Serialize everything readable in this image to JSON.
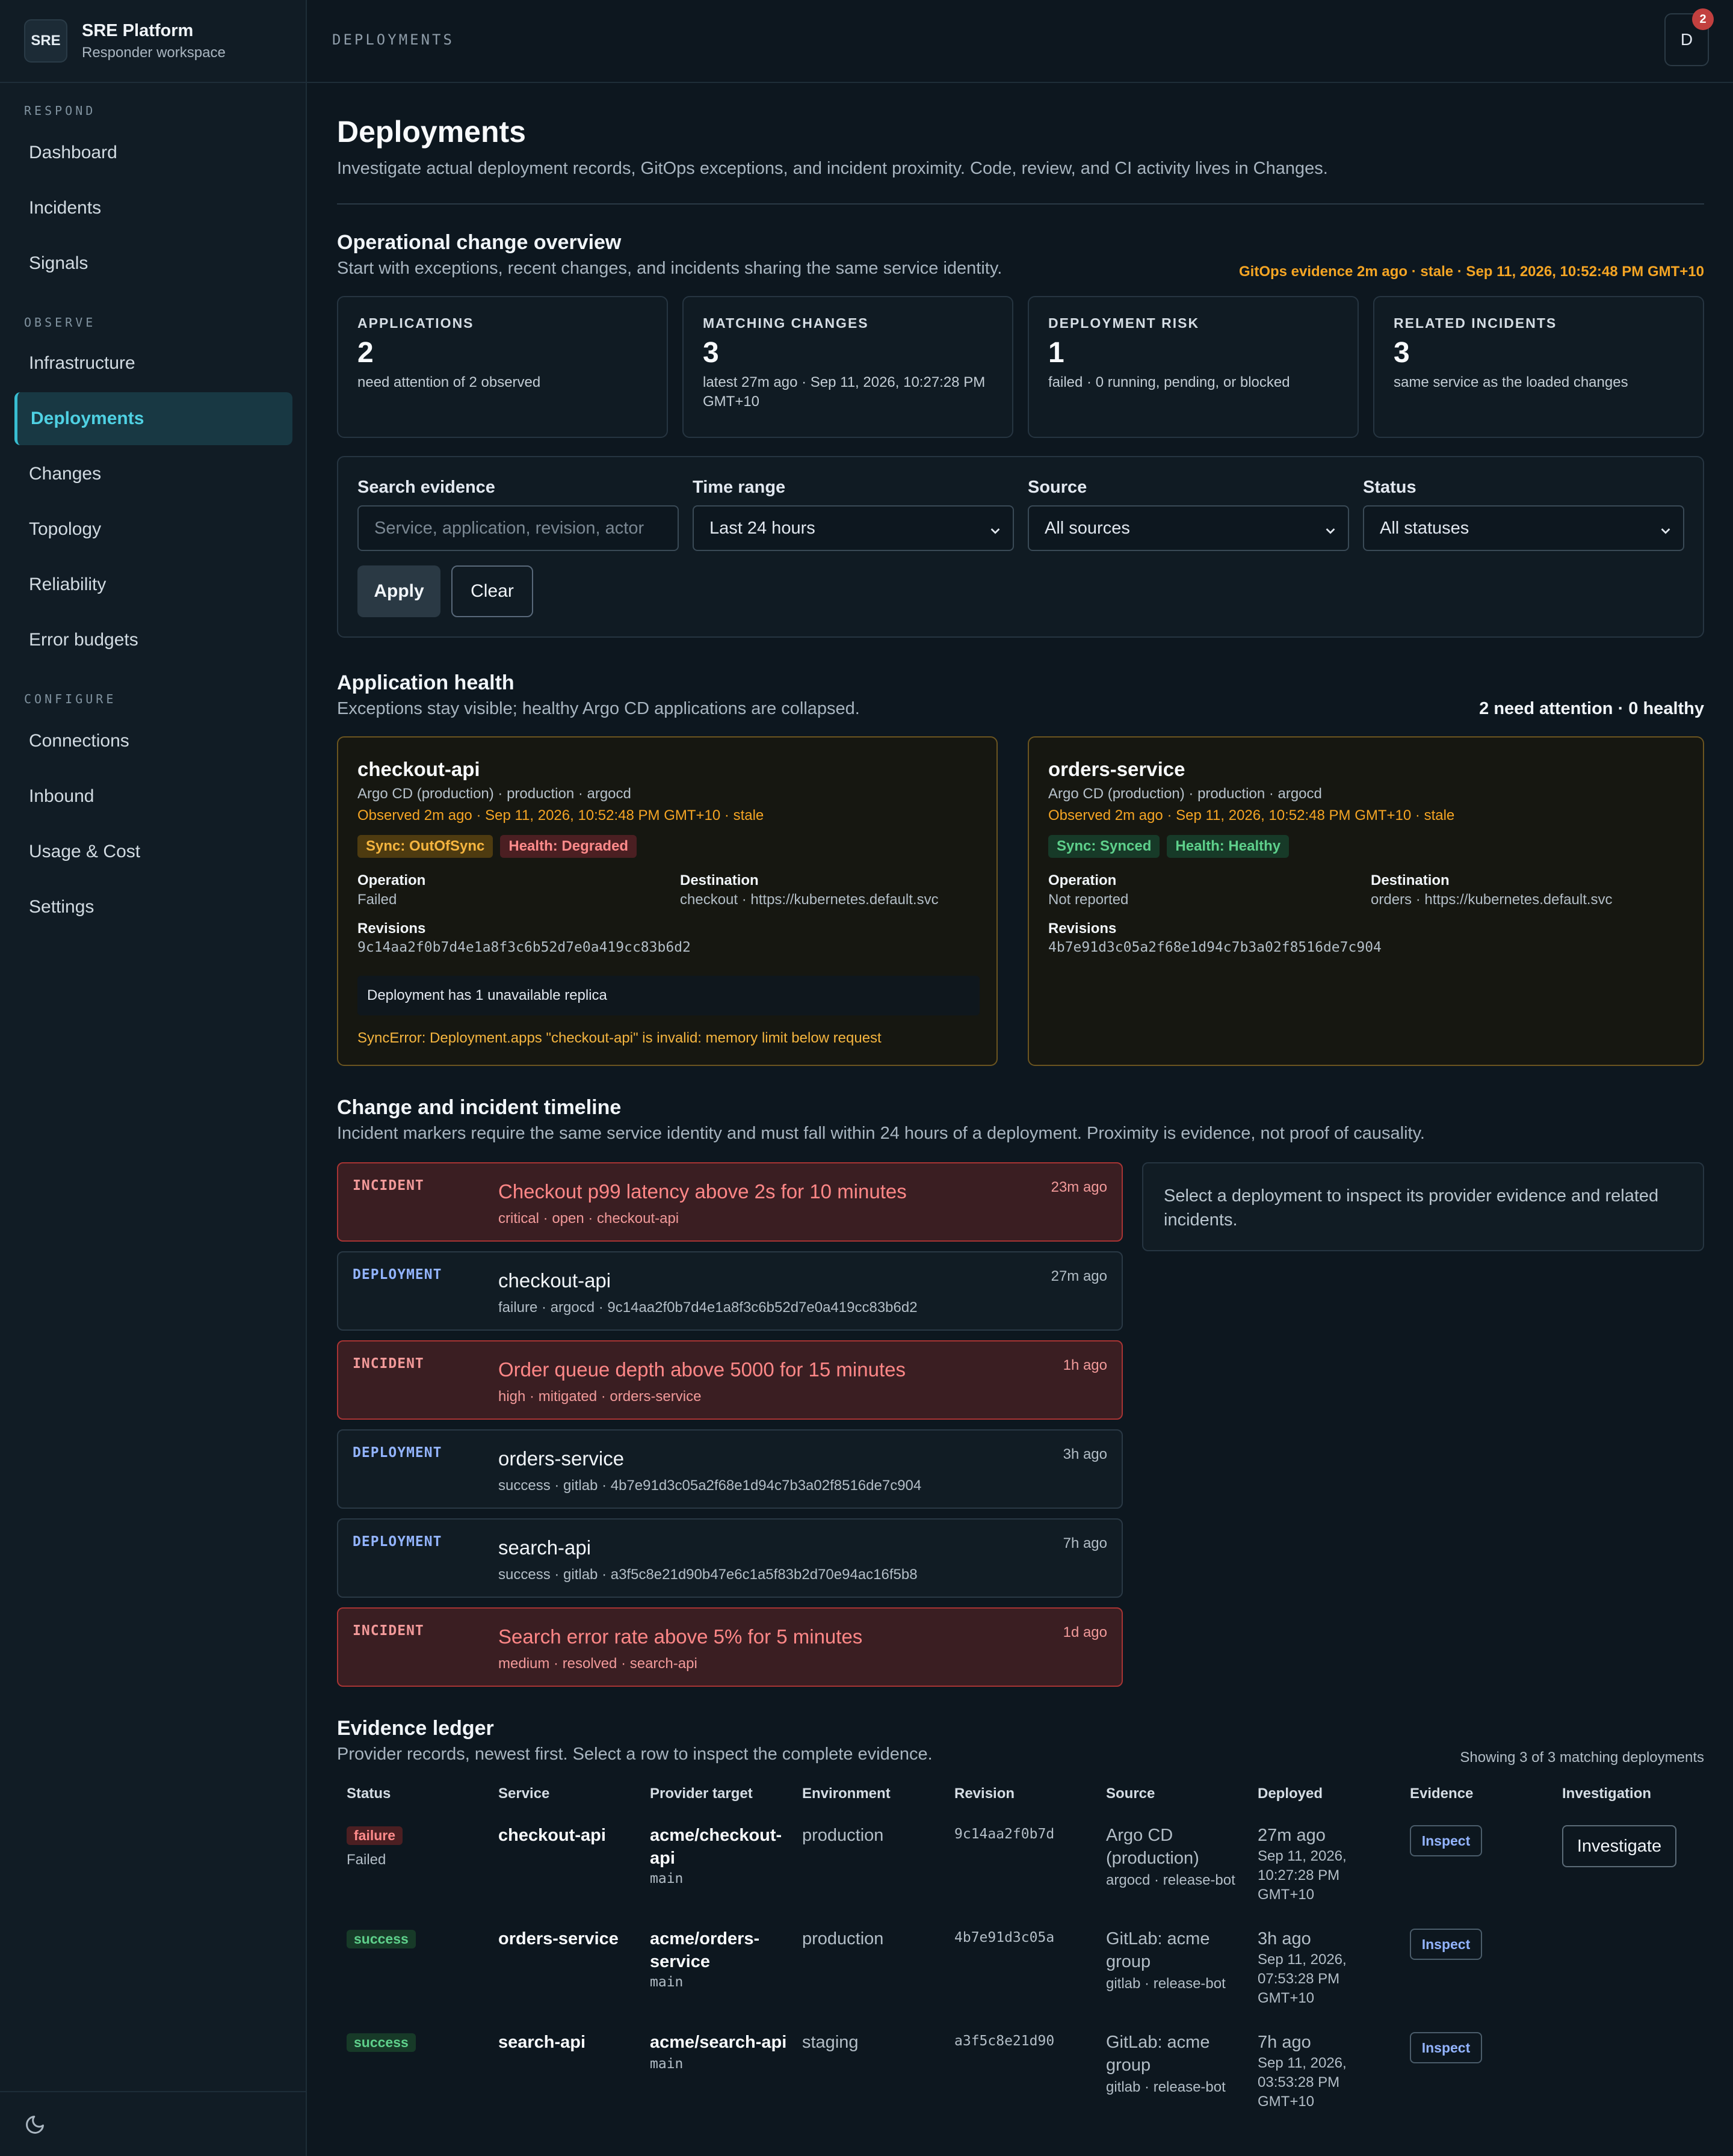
{
  "brand": {
    "logo": "SRE",
    "name": "SRE Platform",
    "subtitle": "Responder workspace"
  },
  "nav": {
    "sections": [
      {
        "label": "RESPOND",
        "items": [
          "Dashboard",
          "Incidents",
          "Signals"
        ]
      },
      {
        "label": "OBSERVE",
        "items": [
          "Infrastructure",
          "Deployments",
          "Changes",
          "Topology",
          "Reliability",
          "Error budgets"
        ]
      },
      {
        "label": "CONFIGURE",
        "items": [
          "Connections",
          "Inbound",
          "Usage & Cost",
          "Settings"
        ]
      }
    ],
    "active": "Deployments"
  },
  "header": {
    "breadcrumb": "DEPLOYMENTS",
    "avatar": "D",
    "notifications": "2"
  },
  "page": {
    "title": "Deployments",
    "description": "Investigate actual deployment records, GitOps exceptions, and incident proximity. Code, review, and CI activity lives in Changes."
  },
  "overview": {
    "title": "Operational change overview",
    "subtitle": "Start with exceptions, recent changes, and incidents sharing the same service identity.",
    "freshness": "GitOps evidence 2m ago · stale · Sep 11, 2026, 10:52:48 PM GMT+10",
    "kpis": [
      {
        "label": "APPLICATIONS",
        "value": "2",
        "note": "need attention of 2 observed"
      },
      {
        "label": "MATCHING CHANGES",
        "value": "3",
        "note": "latest 27m ago · Sep 11, 2026, 10:27:28 PM GMT+10"
      },
      {
        "label": "DEPLOYMENT RISK",
        "value": "1",
        "note": "failed · 0 running, pending, or blocked"
      },
      {
        "label": "RELATED INCIDENTS",
        "value": "3",
        "note": "same service as the loaded changes"
      }
    ]
  },
  "filters": {
    "search_label": "Search evidence",
    "search_placeholder": "Service, application, revision, actor",
    "time_label": "Time range",
    "time_value": "Last 24 hours",
    "source_label": "Source",
    "source_value": "All sources",
    "status_label": "Status",
    "status_value": "All statuses",
    "apply": "Apply",
    "clear": "Clear"
  },
  "health": {
    "title": "Application health",
    "subtitle": "Exceptions stay visible; healthy Argo CD applications are collapsed.",
    "summary": "2 need attention · 0 healthy",
    "apps": [
      {
        "name": "checkout-api",
        "meta": "Argo CD (production) · production · argocd",
        "observed": "Observed 2m ago · Sep 11, 2026, 10:52:48 PM GMT+10 · stale",
        "sync": "Sync: OutOfSync",
        "health": "Health: Degraded",
        "operation_label": "Operation",
        "operation": "Failed",
        "destination_label": "Destination",
        "destination": "checkout · https://kubernetes.default.svc",
        "revisions_label": "Revisions",
        "revision": "9c14aa2f0b7d4e1a8f3c6b52d7e0a419cc83b6d2",
        "condition": "Deployment has 1 unavailable replica",
        "error": "SyncError: Deployment.apps \"checkout-api\" is invalid: memory limit below request"
      },
      {
        "name": "orders-service",
        "meta": "Argo CD (production) · production · argocd",
        "observed": "Observed 2m ago · Sep 11, 2026, 10:52:48 PM GMT+10 · stale",
        "sync": "Sync: Synced",
        "health": "Health: Healthy",
        "operation_label": "Operation",
        "operation": "Not reported",
        "destination_label": "Destination",
        "destination": "orders · https://kubernetes.default.svc",
        "revisions_label": "Revisions",
        "revision": "4b7e91d3c05a2f68e1d94c7b3a02f8516de7c904"
      }
    ]
  },
  "timeline": {
    "title": "Change and incident timeline",
    "subtitle": "Incident markers require the same service identity and must fall within 24 hours of a deployment. Proximity is evidence, not proof of causality.",
    "items": [
      {
        "kind": "INCIDENT",
        "title": "Checkout p99 latency above 2s for 10 minutes",
        "meta": "critical · open · checkout-api",
        "time": "23m ago"
      },
      {
        "kind": "DEPLOYMENT",
        "title": "checkout-api",
        "meta": "failure · argocd · 9c14aa2f0b7d4e1a8f3c6b52d7e0a419cc83b6d2",
        "time": "27m ago"
      },
      {
        "kind": "INCIDENT",
        "title": "Order queue depth above 5000 for 15 minutes",
        "meta": "high · mitigated · orders-service",
        "time": "1h ago"
      },
      {
        "kind": "DEPLOYMENT",
        "title": "orders-service",
        "meta": "success · gitlab · 4b7e91d3c05a2f68e1d94c7b3a02f8516de7c904",
        "time": "3h ago"
      },
      {
        "kind": "DEPLOYMENT",
        "title": "search-api",
        "meta": "success · gitlab · a3f5c8e21d90b47e6c1a5f83b2d70e94ac16f5b8",
        "time": "7h ago"
      },
      {
        "kind": "INCIDENT",
        "title": "Search error rate above 5% for 5 minutes",
        "meta": "medium · resolved · search-api",
        "time": "1d ago"
      }
    ],
    "detail_hint": "Select a deployment to inspect its provider evidence and related incidents."
  },
  "ledger": {
    "title": "Evidence ledger",
    "subtitle": "Provider records, newest first. Select a row to inspect the complete evidence.",
    "count": "Showing 3 of 3 matching deployments",
    "columns": [
      "Status",
      "Service",
      "Provider target",
      "Environment",
      "Revision",
      "Source",
      "Deployed",
      "Evidence",
      "Investigation"
    ],
    "rows": [
      {
        "status": "failure",
        "status_detail": "Failed",
        "service": "checkout-api",
        "target": "acme/checkout-api",
        "branch": "main",
        "environment": "production",
        "revision": "9c14aa2f0b7d",
        "source": "Argo CD (production)",
        "source_detail": "argocd · release-bot",
        "deployed": "27m ago",
        "deployed_at": "Sep 11, 2026, 10:27:28 PM GMT+10",
        "inspect": "Inspect",
        "investigate": "Investigate"
      },
      {
        "status": "success",
        "status_detail": "",
        "service": "orders-service",
        "target": "acme/orders-service",
        "branch": "main",
        "environment": "production",
        "revision": "4b7e91d3c05a",
        "source": "GitLab: acme group",
        "source_detail": "gitlab · release-bot",
        "deployed": "3h ago",
        "deployed_at": "Sep 11, 2026, 07:53:28 PM GMT+10",
        "inspect": "Inspect"
      },
      {
        "status": "success",
        "status_detail": "",
        "service": "search-api",
        "target": "acme/search-api",
        "branch": "main",
        "environment": "staging",
        "revision": "a3f5c8e21d90",
        "source": "GitLab: acme group",
        "source_detail": "gitlab · release-bot",
        "deployed": "7h ago",
        "deployed_at": "Sep 11, 2026, 03:53:28 PM GMT+10",
        "inspect": "Inspect"
      }
    ]
  },
  "colors": {
    "accent": "#38bdd1",
    "warning": "#f5a524",
    "danger": "#ff8787",
    "success": "#5ed08b",
    "deploy": "#93b4ff"
  },
  "icons": {
    "theme_toggle": "moon-icon",
    "select": "chevron-down-icon"
  }
}
